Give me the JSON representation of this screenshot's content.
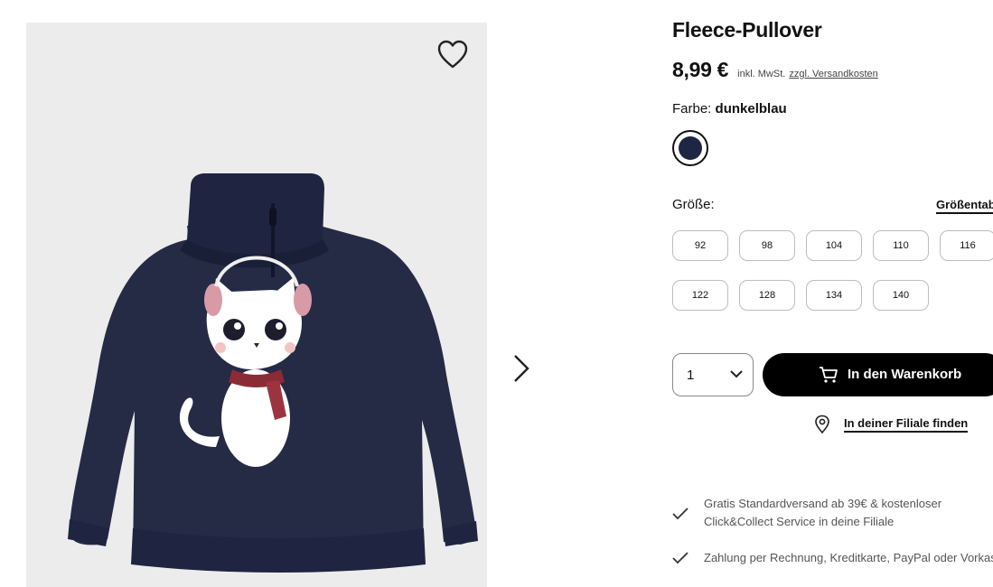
{
  "product": {
    "title": "Fleece-Pullover",
    "price": "8,99 €",
    "vat_note": "inkl. MwSt.",
    "shipping_link": "zzgl. Versandkosten",
    "color_label": "Farbe:",
    "color_value": "dunkelblau",
    "swatch_color": "#1f2642",
    "size_label": "Größe:",
    "size_table_link": "Größentab",
    "sizes": [
      "92",
      "98",
      "104",
      "110",
      "116",
      "122",
      "128",
      "134",
      "140"
    ]
  },
  "purchase": {
    "quantity": "1",
    "add_to_cart": "In den Warenkorb",
    "find_in_store": "In deiner Filiale finden"
  },
  "usps": {
    "line1a": "Gratis Standardversand ab 39€ & kostenloser",
    "line1b": "Click&Collect Service in deine Filiale",
    "line2": "Zahlung per Rechnung, Kreditkarte, PayPal oder Vorkass"
  },
  "icons": {
    "wishlist": "heart-icon",
    "next": "chevron-right-icon",
    "quantity": "chevron-down-icon",
    "cart": "shopping-cart-icon",
    "store": "location-pin-icon",
    "usp": "check-icon"
  },
  "colors": {
    "gallery_bg": "#ececec",
    "sweater": "#252a45",
    "primary_button": "#000000"
  }
}
